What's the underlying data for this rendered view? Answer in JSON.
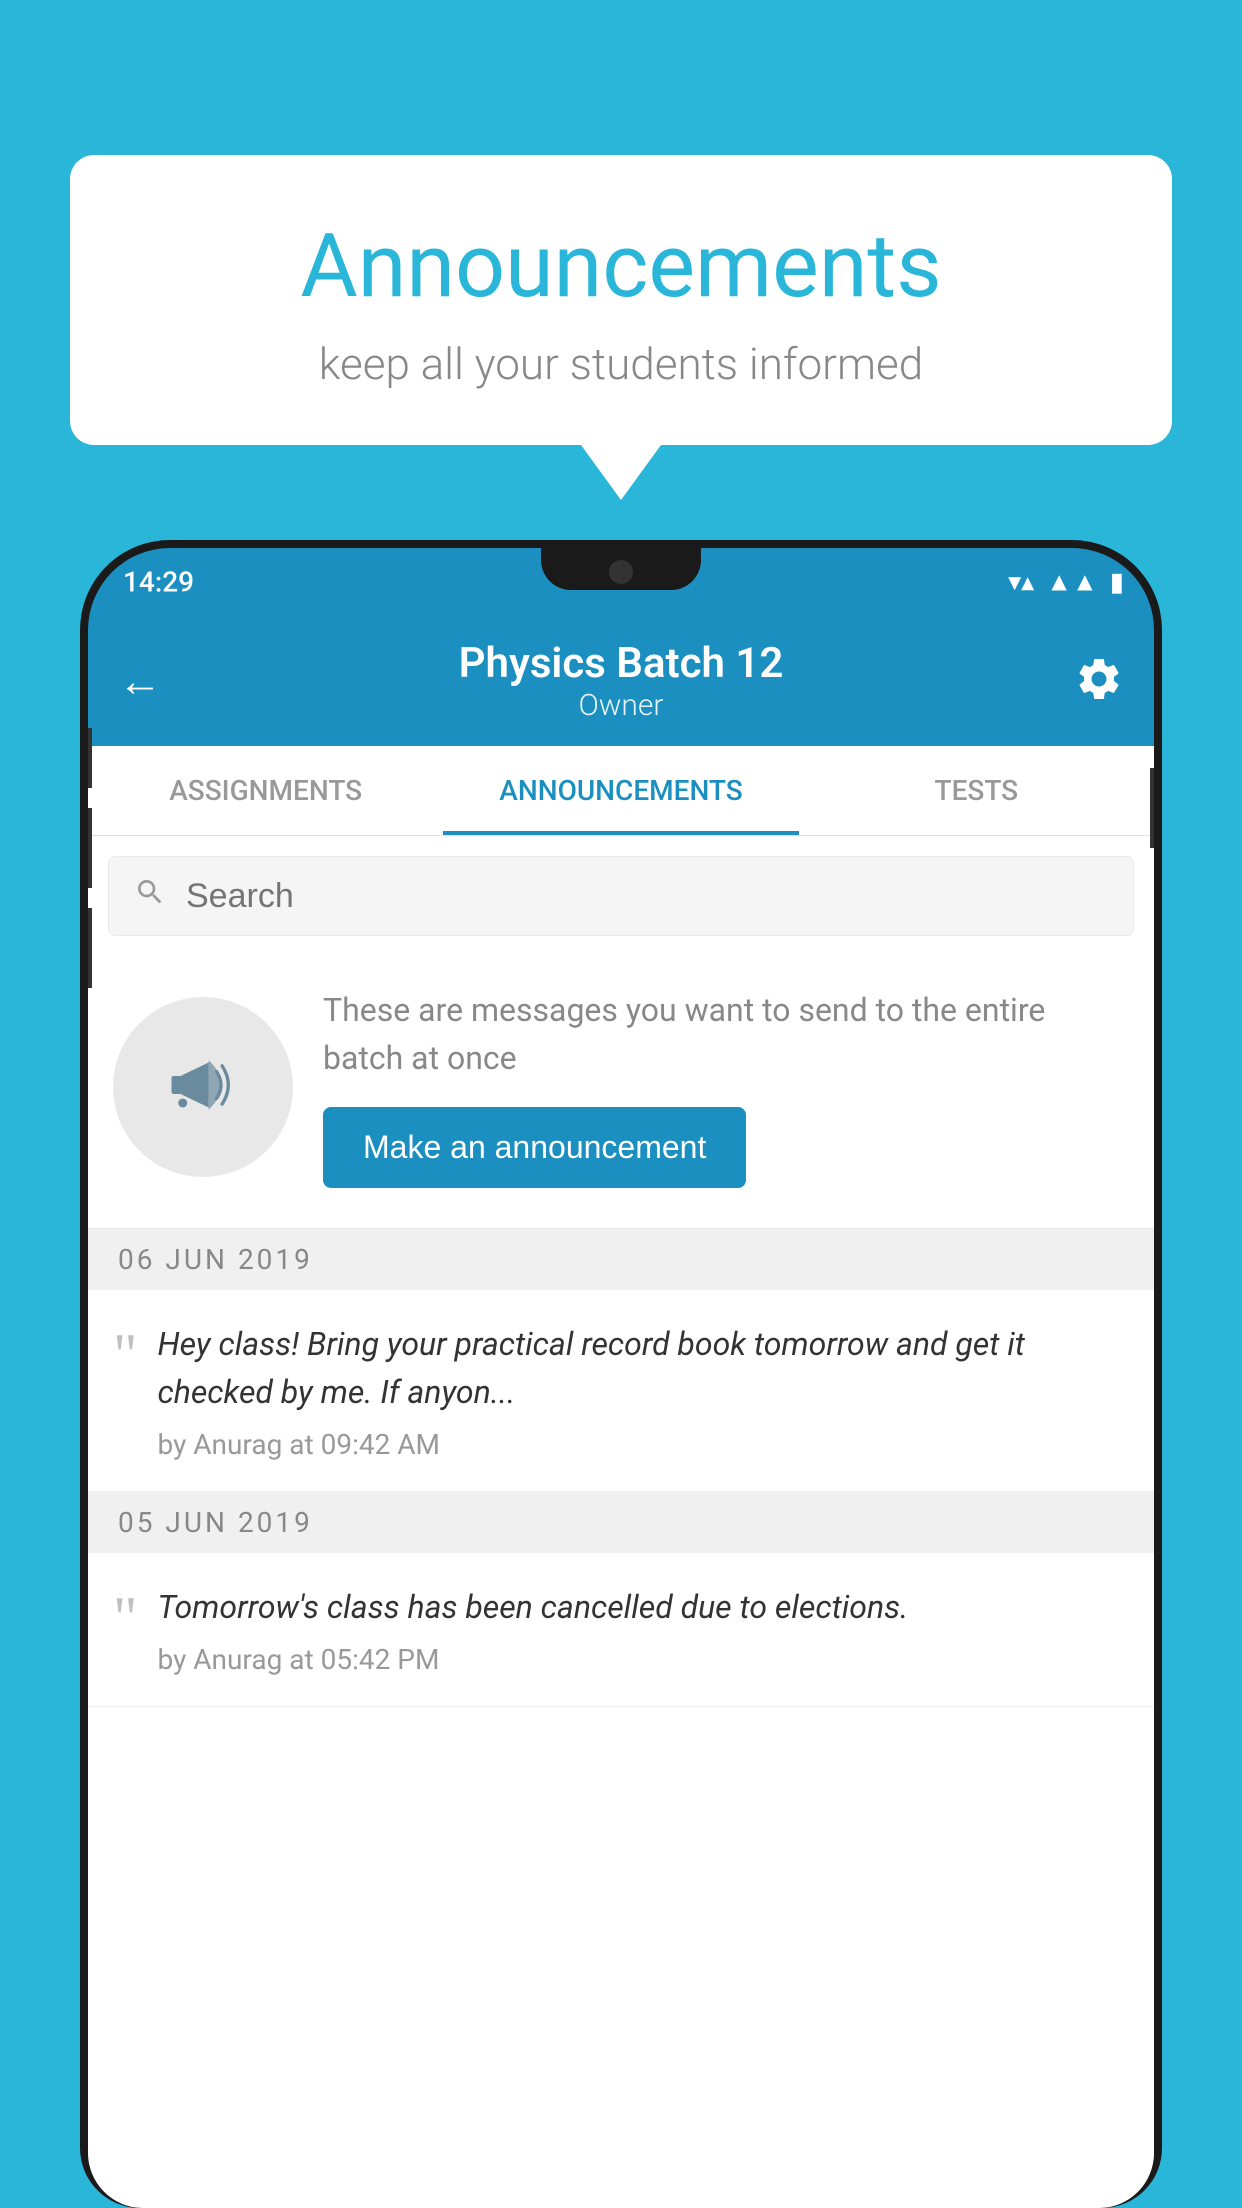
{
  "background_color": "#29b6d8",
  "speech_bubble": {
    "title": "Announcements",
    "subtitle": "keep all your students informed"
  },
  "phone": {
    "status_bar": {
      "time": "14:29",
      "icons": [
        "wifi",
        "signal",
        "battery"
      ]
    },
    "header": {
      "title": "Physics Batch 12",
      "subtitle": "Owner",
      "back_label": "←",
      "settings_label": "Settings"
    },
    "tabs": [
      {
        "label": "ASSIGNMENTS",
        "active": false
      },
      {
        "label": "ANNOUNCEMENTS",
        "active": true
      },
      {
        "label": "TESTS",
        "active": false
      }
    ],
    "search": {
      "placeholder": "Search"
    },
    "empty_state": {
      "description": "These are messages you want to send to the entire batch at once",
      "cta_label": "Make an announcement"
    },
    "announcements": [
      {
        "date": "06  JUN  2019",
        "messages": [
          {
            "text": "Hey class! Bring your practical record book tomorrow and get it checked by me. If anyon...",
            "meta": "by Anurag at 09:42 AM"
          }
        ]
      },
      {
        "date": "05  JUN  2019",
        "messages": [
          {
            "text": "Tomorrow's class has been cancelled due to elections.",
            "meta": "by Anurag at 05:42 PM"
          }
        ]
      }
    ]
  }
}
